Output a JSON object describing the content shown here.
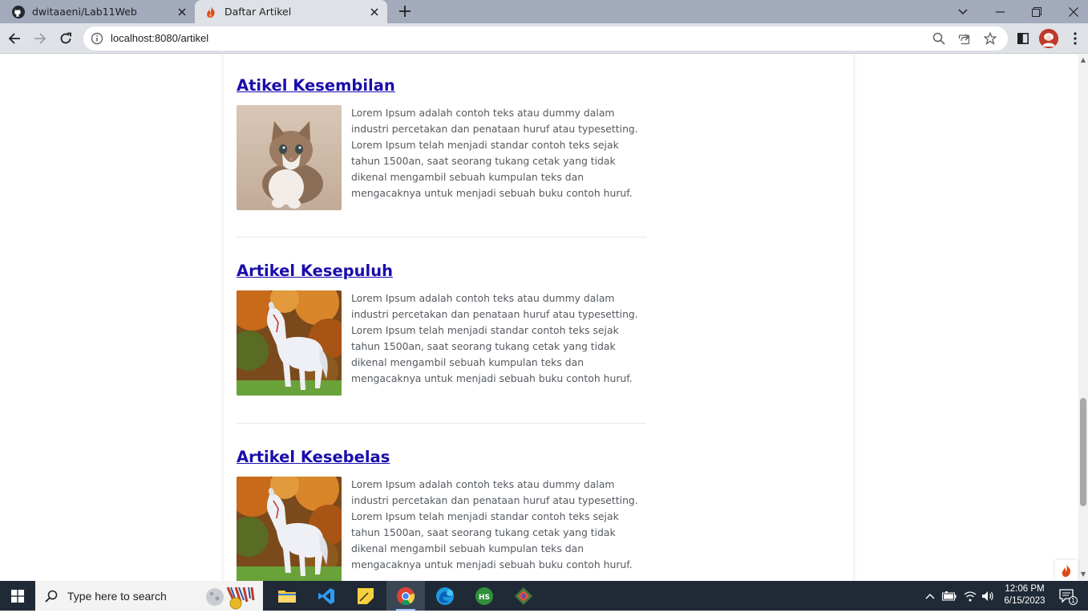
{
  "browser": {
    "tabs": [
      {
        "title": "dwitaaeni/Lab11Web",
        "icon": "github-icon",
        "active": false
      },
      {
        "title": "Daftar Artikel",
        "icon": "codeigniter-flame-icon",
        "active": true
      }
    ],
    "url": "localhost:8080/artikel"
  },
  "articles": [
    {
      "title": "Atikel Kesembilan",
      "image": "kitten-photo",
      "body": "Lorem Ipsum adalah contoh teks atau dummy dalam industri percetakan dan penataan huruf atau typesetting. Lorem Ipsum telah menjadi standar contoh teks sejak tahun 1500an, saat seorang tukang cetak yang tidak dikenal mengambil sebuah kumpulan teks dan mengacaknya untuk menjadi sebuah buku contoh huruf."
    },
    {
      "title": "Artikel Kesepuluh",
      "image": "white-horse-photo",
      "body": "Lorem Ipsum adalah contoh teks atau dummy dalam industri percetakan dan penataan huruf atau typesetting. Lorem Ipsum telah menjadi standar contoh teks sejak tahun 1500an, saat seorang tukang cetak yang tidak dikenal mengambil sebuah kumpulan teks dan mengacaknya untuk menjadi sebuah buku contoh huruf."
    },
    {
      "title": "Artikel Kesebelas",
      "image": "white-horse-photo",
      "body": "Lorem Ipsum adalah contoh teks atau dummy dalam industri percetakan dan penataan huruf atau typesetting. Lorem Ipsum telah menjadi standar contoh teks sejak tahun 1500an, saat seorang tukang cetak yang tidak dikenal mengambil sebuah kumpulan teks dan mengacaknya untuk menjadi sebuah buku contoh huruf."
    }
  ],
  "taskbar": {
    "search_placeholder": "Type here to search",
    "time": "12:06 PM",
    "date": "6/15/2023",
    "notification_count": "1"
  },
  "colors": {
    "link": "#1a0dab",
    "tab_strip": "#a3aabb",
    "toolbar": "#dee1e6",
    "taskbar": "#202a36"
  }
}
